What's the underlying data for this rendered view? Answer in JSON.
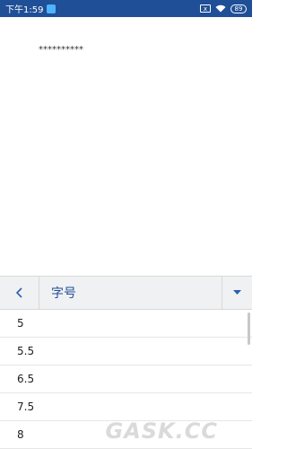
{
  "status_bar": {
    "time": "下午1:59",
    "sim_label": "x",
    "battery": "89"
  },
  "document": {
    "text": "**********"
  },
  "panel": {
    "title": "字号"
  },
  "font_sizes": [
    "5",
    "5.5",
    "6.5",
    "7.5",
    "8"
  ],
  "watermark": "GASK.CC",
  "colors": {
    "status_bar": "#1f4f96",
    "accent": "#2b5fb0",
    "panel_bg": "#f0f1f3"
  }
}
